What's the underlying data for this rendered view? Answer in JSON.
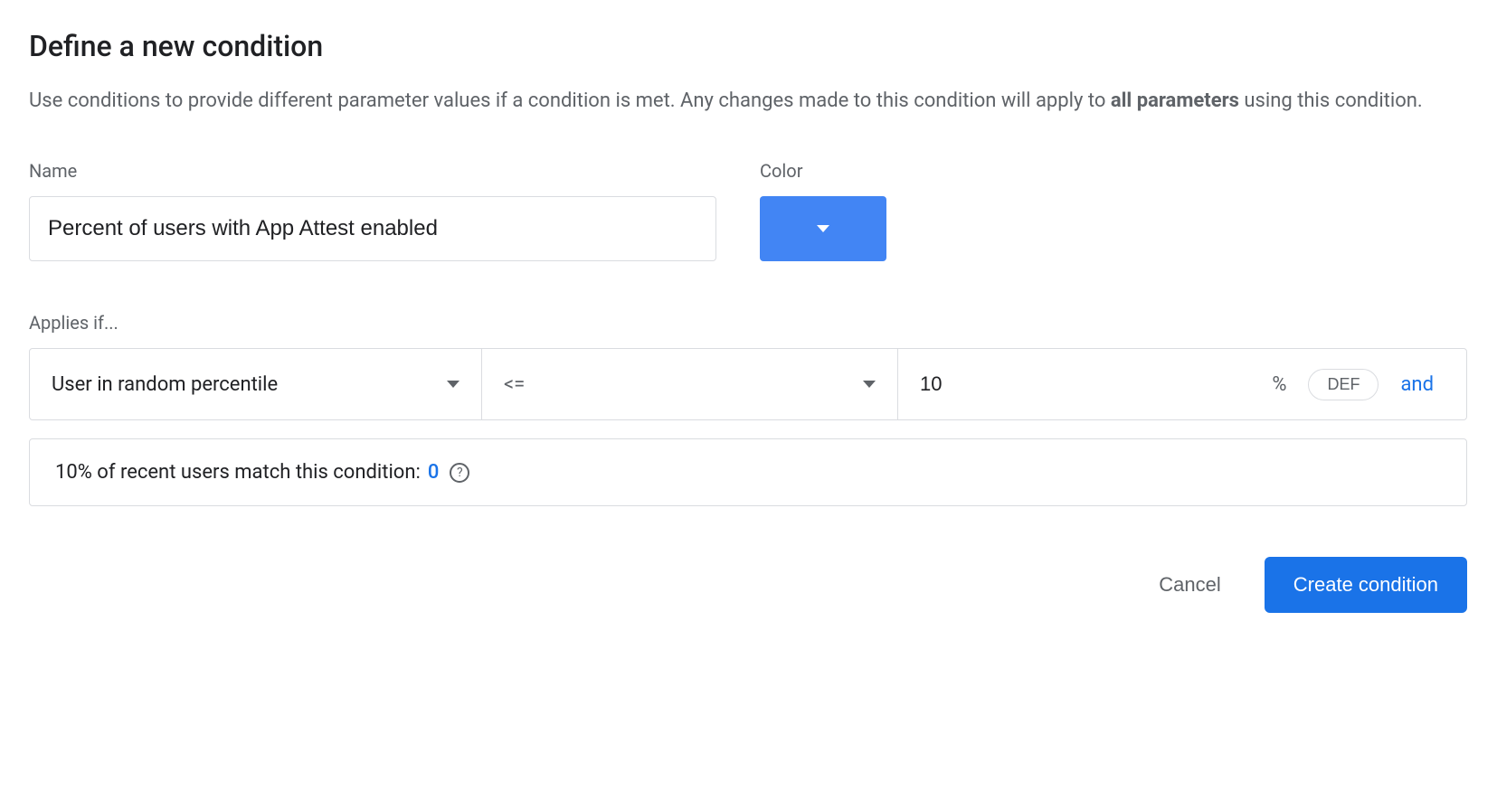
{
  "title": "Define a new condition",
  "description_part1": "Use conditions to provide different parameter values if a condition is met. Any changes made to this condition will apply to ",
  "description_bold": "all parameters",
  "description_part2": " using this condition.",
  "name": {
    "label": "Name",
    "value": "Percent of users with App Attest enabled"
  },
  "color": {
    "label": "Color",
    "value": "#4285f4"
  },
  "applies_label": "Applies if...",
  "rule": {
    "type": "User in random percentile",
    "operator": "<=",
    "value": "10",
    "unit": "%",
    "def_label": "DEF",
    "and_label": "and"
  },
  "match": {
    "text": "10% of recent users match this condition: ",
    "count": "0"
  },
  "actions": {
    "cancel": "Cancel",
    "create": "Create condition"
  }
}
